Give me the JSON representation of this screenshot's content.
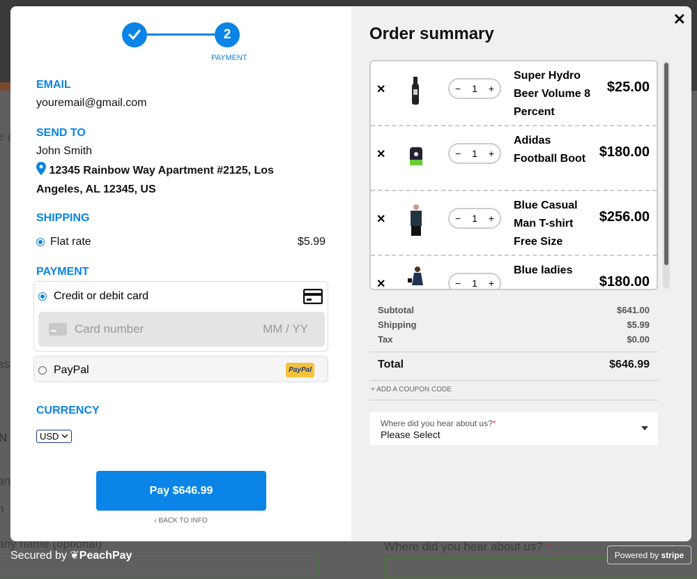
{
  "background": {
    "fragments": [
      "e a",
      "ase",
      "N",
      "an",
      "n",
      "any name (optional)",
      "Where did you hear about us?",
      "*"
    ]
  },
  "stepper": {
    "step1_icon": "check-icon",
    "step2_number": "2",
    "step2_label": "PAYMENT"
  },
  "email": {
    "heading": "EMAIL",
    "value": "youremail@gmail.com"
  },
  "send_to": {
    "heading": "SEND TO",
    "name": "John Smith",
    "address": "12345 Rainbow Way Apartment #2125, Los Angeles, AL 12345, US"
  },
  "shipping": {
    "heading": "SHIPPING",
    "option": "Flat rate",
    "price": "$5.99",
    "selected": true
  },
  "payment": {
    "heading": "PAYMENT",
    "card_label": "Credit or debit card",
    "card_placeholder": "Card number",
    "expiry_placeholder": "MM / YY",
    "paypal_label": "PayPal",
    "paypal_logo": "PayPal",
    "selected": "card"
  },
  "currency": {
    "heading": "CURRENCY",
    "selected": "USD"
  },
  "pay_button": "Pay $646.99",
  "back_link": "BACK TO INFO",
  "summary": {
    "title": "Order summary",
    "items": [
      {
        "name": "Super Hydro Beer Volume 8 Percent",
        "qty": "1",
        "price": "$25.00"
      },
      {
        "name": "Adidas Football Boot",
        "qty": "1",
        "price": "$180.00"
      },
      {
        "name": "Blue Casual Man T-shirt Free Size",
        "qty": "1",
        "price": "$256.00"
      },
      {
        "name": "Blue ladies",
        "qty": "1",
        "price": "$180.00"
      }
    ],
    "subtotal_label": "Subtotal",
    "subtotal": "$641.00",
    "shipping_label": "Shipping",
    "shipping": "$5.99",
    "tax_label": "Tax",
    "tax": "$0.00",
    "total_label": "Total",
    "total": "$646.99",
    "coupon": "+ ADD A COUPON CODE",
    "hear_label": "Where did you hear about us?",
    "required_mark": "*",
    "hear_value": "Please Select"
  },
  "footer": {
    "secured": "Secured by",
    "brand": "PeachPay",
    "powered": "Powered by",
    "stripe": "stripe"
  },
  "colors": {
    "accent": "#0a84e6",
    "panel": "#f0f0f0"
  }
}
